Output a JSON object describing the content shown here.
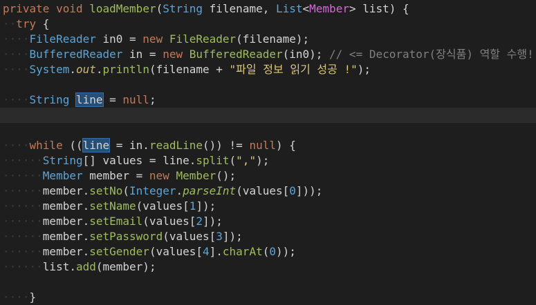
{
  "editor": {
    "lines": [
      [
        [
          "kw",
          "private"
        ],
        [
          "var",
          " "
        ],
        [
          "kw",
          "void"
        ],
        [
          "var",
          " "
        ],
        [
          "method",
          "loadMember"
        ],
        [
          "var",
          "("
        ],
        [
          "type",
          "String"
        ],
        [
          "var",
          " filename, "
        ],
        [
          "type",
          "List"
        ],
        [
          "var",
          "<"
        ],
        [
          "gen",
          "Member"
        ],
        [
          "var",
          "> list) {"
        ]
      ],
      [
        [
          "ws",
          "··"
        ],
        [
          "kw",
          "try"
        ],
        [
          "var",
          " {"
        ]
      ],
      [
        [
          "ws",
          "····"
        ],
        [
          "type",
          "FileReader"
        ],
        [
          "var",
          " in0 = "
        ],
        [
          "kw",
          "new"
        ],
        [
          "var",
          " "
        ],
        [
          "method",
          "FileReader"
        ],
        [
          "var",
          "(filename);"
        ]
      ],
      [
        [
          "ws",
          "····"
        ],
        [
          "type",
          "BufferedReader"
        ],
        [
          "var",
          " in = "
        ],
        [
          "kw",
          "new"
        ],
        [
          "var",
          " "
        ],
        [
          "method",
          "BufferedReader"
        ],
        [
          "var",
          "(in0); "
        ],
        [
          "cmt",
          "// <= Decorator(장식품) 역할 수행!"
        ]
      ],
      [
        [
          "ws",
          "····"
        ],
        [
          "type",
          "System"
        ],
        [
          "var",
          "."
        ],
        [
          "field it",
          "out"
        ],
        [
          "var",
          "."
        ],
        [
          "method",
          "println"
        ],
        [
          "var",
          "(filename + "
        ],
        [
          "str",
          "\"파일 정보 읽기 성공 !\""
        ],
        [
          "var",
          ");"
        ]
      ],
      [],
      [
        [
          "ws",
          "····"
        ],
        [
          "type",
          "String"
        ],
        [
          "var",
          " "
        ],
        [
          "sel",
          "line"
        ],
        [
          "var",
          " = "
        ],
        [
          "kw",
          "null"
        ],
        [
          "var",
          ";"
        ]
      ],
      [],
      [],
      [
        [
          "ws",
          "····"
        ],
        [
          "kw",
          "while"
        ],
        [
          "var",
          " (("
        ],
        [
          "sel",
          "line"
        ],
        [
          "var",
          " = in."
        ],
        [
          "method",
          "readLine"
        ],
        [
          "var",
          "()) != "
        ],
        [
          "kw",
          "null"
        ],
        [
          "var",
          ") {"
        ]
      ],
      [
        [
          "ws",
          "······"
        ],
        [
          "type",
          "String"
        ],
        [
          "var",
          "[] values = line."
        ],
        [
          "method",
          "split"
        ],
        [
          "var",
          "("
        ],
        [
          "str",
          "\",\""
        ],
        [
          "var",
          ");"
        ]
      ],
      [
        [
          "ws",
          "······"
        ],
        [
          "type",
          "Member"
        ],
        [
          "var",
          " member = "
        ],
        [
          "kw",
          "new"
        ],
        [
          "var",
          " "
        ],
        [
          "method",
          "Member"
        ],
        [
          "var",
          "();"
        ]
      ],
      [
        [
          "ws",
          "······"
        ],
        [
          "var",
          "member."
        ],
        [
          "method",
          "setNo"
        ],
        [
          "var",
          "("
        ],
        [
          "type",
          "Integer"
        ],
        [
          "var",
          "."
        ],
        [
          "method it",
          "parseInt"
        ],
        [
          "var",
          "(values["
        ],
        [
          "num",
          "0"
        ],
        [
          "var",
          "]));"
        ]
      ],
      [
        [
          "ws",
          "······"
        ],
        [
          "var",
          "member."
        ],
        [
          "method",
          "setName"
        ],
        [
          "var",
          "(values["
        ],
        [
          "num",
          "1"
        ],
        [
          "var",
          "]);"
        ]
      ],
      [
        [
          "ws",
          "······"
        ],
        [
          "var",
          "member."
        ],
        [
          "method",
          "setEmail"
        ],
        [
          "var",
          "(values["
        ],
        [
          "num",
          "2"
        ],
        [
          "var",
          "]);"
        ]
      ],
      [
        [
          "ws",
          "······"
        ],
        [
          "var",
          "member."
        ],
        [
          "method",
          "setPassword"
        ],
        [
          "var",
          "(values["
        ],
        [
          "num",
          "3"
        ],
        [
          "var",
          "]);"
        ]
      ],
      [
        [
          "ws",
          "······"
        ],
        [
          "var",
          "member."
        ],
        [
          "method",
          "setGender"
        ],
        [
          "var",
          "(values["
        ],
        [
          "num",
          "4"
        ],
        [
          "var",
          "]."
        ],
        [
          "method",
          "charAt"
        ],
        [
          "var",
          "("
        ],
        [
          "num",
          "0"
        ],
        [
          "var",
          "));"
        ]
      ],
      [
        [
          "ws",
          "······"
        ],
        [
          "var",
          "list."
        ],
        [
          "method",
          "add"
        ],
        [
          "var",
          "(member);"
        ]
      ],
      [],
      [
        [
          "ws",
          "····"
        ],
        [
          "var",
          "}"
        ]
      ]
    ],
    "current_line": 7
  }
}
